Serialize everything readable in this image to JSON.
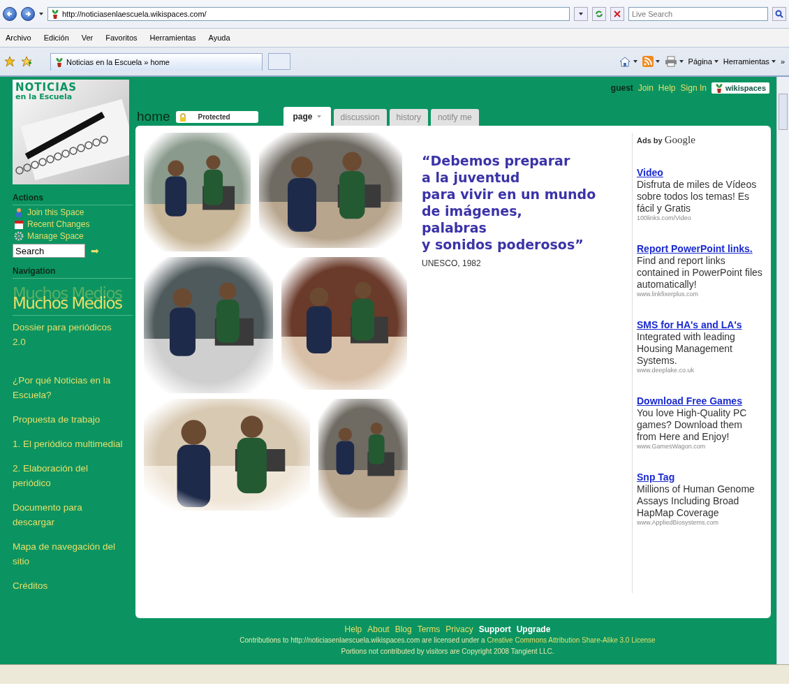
{
  "browser": {
    "address": "http://noticiasenlaescuela.wikispaces.com/",
    "search_placeholder": "Live Search",
    "menu": [
      "Archivo",
      "Edición",
      "Ver",
      "Favoritos",
      "Herramientas",
      "Ayuda"
    ],
    "tab": "Noticias en la Escuela » home",
    "toolbar": [
      {
        "kind": "home"
      },
      {
        "kind": "feed"
      },
      {
        "kind": "print"
      },
      {
        "kind": "text",
        "label": "Página"
      },
      {
        "kind": "text",
        "label": "Herramientas"
      }
    ],
    "overflow": "»"
  },
  "sidebar": {
    "logo_lines": [
      "NOTICIAS",
      "en la Escuela"
    ],
    "actions_heading": "Actions",
    "actions": [
      {
        "kind": "person",
        "label": "Join this Space"
      },
      {
        "kind": "calendar",
        "label": "Recent Changes"
      },
      {
        "kind": "gear",
        "label": "Manage Space"
      }
    ],
    "search_value": "Search",
    "search_go": "➡",
    "navigation_heading": "Navigation",
    "nav_banner": "Muchos Medios",
    "nav_items": [
      {
        "label": "Dossier para periódicos 2.0"
      },
      {
        "label": "¿Por qué Noticias en la Escuela?"
      },
      {
        "label": "Propuesta de trabajo"
      },
      {
        "label": "1. El periódico multimedial"
      },
      {
        "label": "2. Elaboración del periódico"
      },
      {
        "label": "Documento para descargar"
      },
      {
        "label": "Mapa de navegación del sitio"
      },
      {
        "label": "Créditos"
      }
    ]
  },
  "user_bar": {
    "user": "guest",
    "links": [
      "Join",
      "Help",
      "Sign In"
    ],
    "brand": "wikispaces"
  },
  "page_title": "home",
  "protected": "Protected",
  "tabs": [
    {
      "label": "page",
      "selected": true
    },
    {
      "label": "discussion",
      "selected": false
    },
    {
      "label": "history",
      "selected": false
    },
    {
      "label": "notify me",
      "selected": false
    }
  ],
  "collage": [
    {
      "kind": "picture"
    },
    {
      "kind": "picture"
    },
    {
      "kind": "picture"
    },
    {
      "kind": "picture"
    },
    {
      "kind": "picture"
    },
    {
      "kind": "picture"
    }
  ],
  "quote": [
    "“Debemos preparar",
    "a la juventud",
    "para vivir en un mundo",
    "de imágenes,",
    "palabras",
    "y sonidos poderosos”"
  ],
  "quote_source": "UNESCO, 1982",
  "ads_heading": {
    "prefix": "Ads by",
    "brand": "Google"
  },
  "ads": [
    {
      "title": "Video",
      "text": "Disfruta de miles de Vídeos sobre todos los temas! Es fácil y Gratis",
      "url": "100links.com/Video"
    },
    {
      "title": "Report PowerPoint links.",
      "text": "Find and report links contained in PowerPoint files automatically!",
      "url": "www.linkfixerplus.com"
    },
    {
      "title": "SMS for HA's and LA's",
      "text": "Integrated with leading Housing Management Systems.",
      "url": "www.deeplake.co.uk"
    },
    {
      "title": "Download Free Games",
      "text": "You love High-Quality PC games? Download them from Here and Enjoy!",
      "url": "www.GamesWagon.com"
    },
    {
      "title": "Snp Tag",
      "text": "Millions of Human Genome Assays Including Broad HapMap Coverage",
      "url": "www.AppliedBiosystems.com"
    }
  ],
  "footer": {
    "links": [
      {
        "label": "Help",
        "bold": false
      },
      {
        "label": "About",
        "bold": false
      },
      {
        "label": "Blog",
        "bold": false
      },
      {
        "label": "Terms",
        "bold": false
      },
      {
        "label": "Privacy",
        "bold": false
      },
      {
        "label": "Support",
        "bold": true
      },
      {
        "label": "Upgrade",
        "bold": true
      }
    ],
    "license_text": "Contributions to http://noticiasenlaescuela.wikispaces.com are licensed under a",
    "license_link": "Creative Commons Attribution Share-Alike 3.0 License",
    "copyright": "Portions not contributed by visitors are Copyright 2008 Tangient LLC."
  }
}
